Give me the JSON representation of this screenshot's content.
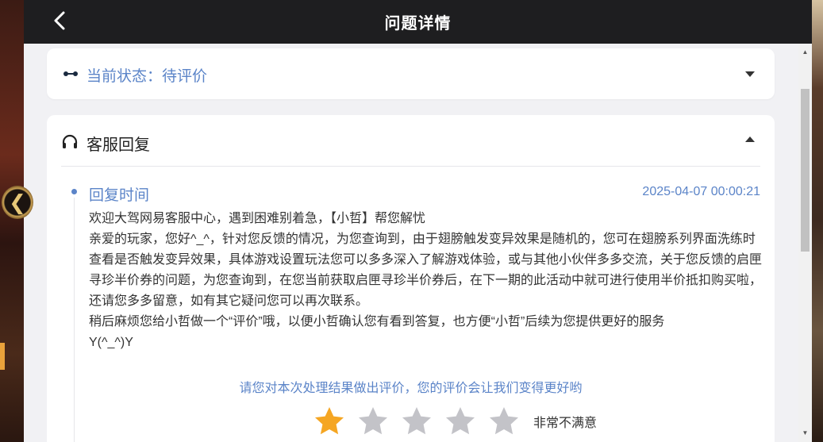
{
  "header": {
    "title": "问题详情",
    "back_icon": "chevron-left-icon"
  },
  "status": {
    "text": "当前状态：待评价",
    "icon": "dots-icon",
    "toggle_icon": "caret-down-icon"
  },
  "reply": {
    "section_title": "客服回复",
    "icon": "headset-icon",
    "toggle_icon": "caret-up-icon",
    "time_label": "回复时间",
    "time_value": "2025-04-07 00:00:21",
    "lines": [
      "欢迎大驾网易客服中心，遇到困难别着急，【小哲】帮您解忧",
      "亲爱的玩家，您好^_^，针对您反馈的情况，为您查询到，由于翅膀触发变异效果是随机的，您可在翅膀系列界面洗练时查看是否触发变异效果，具体游戏设置玩法您可以多多深入了解游戏体验，或与其他小伙伴多多交流，关于您反馈的启匣寻珍半价券的问题，为您查询到，在您当前获取启匣寻珍半价券后，在下一期的此活动中就可进行使用半价抵扣购买啦，还请您多多留意，如有其它疑问您可以再次联系。",
      "稍后麻烦您给小哲做一个“评价”哦，以便小哲确认您有看到答复，也方便“小哲”后续为您提供更好的服务",
      "Y(^_^)Y"
    ]
  },
  "rating": {
    "prompt": "请您对本次处理结果做出评价，您的评价会让我们变得更好哟",
    "max_stars": 5,
    "selected_stars": 1,
    "label": "非常不满意",
    "star_icon": "star-icon"
  },
  "colors": {
    "accent": "#5b84c8",
    "star_active": "#f5a623",
    "star_inactive": "#c3c3c8",
    "topbar": "#1e1e20",
    "panel_bg": "#f1f1f4"
  }
}
